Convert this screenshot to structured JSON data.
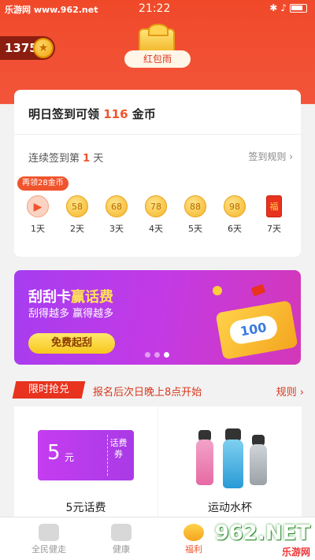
{
  "status_bar": {
    "site": "乐游网 www.962.net",
    "time": "21:22"
  },
  "header": {
    "coins": "1375",
    "coin_symbol": "★",
    "red_packet_label": "红包雨"
  },
  "checkin": {
    "title_prefix": "明日签到可领 ",
    "title_amount": "116",
    "title_suffix": " 金币",
    "streak_prefix": "连续签到第 ",
    "streak_days": "1",
    "streak_suffix": " 天",
    "rules_label": "签到规则 ›",
    "bonus_tag": "再领28金币",
    "days": [
      {
        "value": "▶",
        "label": "1天"
      },
      {
        "value": "58",
        "label": "2天"
      },
      {
        "value": "68",
        "label": "3天"
      },
      {
        "value": "78",
        "label": "4天"
      },
      {
        "value": "88",
        "label": "5天"
      },
      {
        "value": "98",
        "label": "6天"
      },
      {
        "value": "福",
        "label": "7天"
      }
    ]
  },
  "banner": {
    "title_a": "刮刮卡",
    "title_b": "赢话费",
    "subtitle": "刮得越多 赢得越多",
    "button": "免费起刮",
    "card_value": "100"
  },
  "flash_sale": {
    "tag": "限时抢兑",
    "subtitle": "报名后次日晚上8点开始",
    "rules": "规则 ›"
  },
  "products": [
    {
      "name": "5元话费",
      "ticket_value": "5",
      "ticket_unit": "元",
      "ticket_side": "话费券"
    },
    {
      "name": "运动水杯"
    }
  ],
  "tabbar": [
    {
      "label": "全民健走"
    },
    {
      "label": "健康"
    },
    {
      "label": "福利"
    }
  ],
  "watermark": {
    "main": "962.NET",
    "sub": "乐游网"
  }
}
